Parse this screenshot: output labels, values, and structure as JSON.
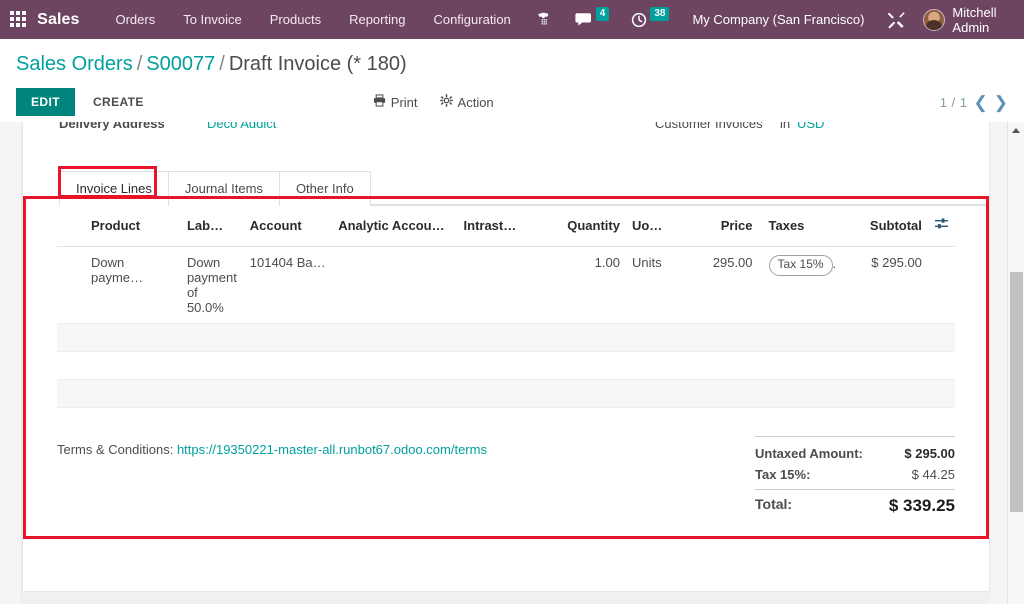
{
  "navbar": {
    "apps_icon": "apps-grid-icon",
    "brand": "Sales",
    "menu": [
      {
        "label": "Orders"
      },
      {
        "label": "To Invoice"
      },
      {
        "label": "Products"
      },
      {
        "label": "Reporting"
      },
      {
        "label": "Configuration"
      }
    ],
    "phone_icon": "phone-icon",
    "messages_icon": "chat-bubble-icon",
    "messages_count": "4",
    "activities_icon": "clock-icon",
    "activities_count": "38",
    "company": "My Company (San Francisco)",
    "debug_icon": "tools-icon",
    "user_name": "Mitchell Admin",
    "avatar": "user-avatar",
    "bg_color": "#6e4561",
    "badge_color": "#00A09D"
  },
  "breadcrumb": {
    "root": "Sales Orders",
    "parent": "S00077",
    "current": "Draft Invoice (* 180)",
    "separator": "/"
  },
  "controlpanel": {
    "edit_label": "EDIT",
    "create_label": "CREATE",
    "print_label": "Print",
    "print_icon": "printer-icon",
    "action_label": "Action",
    "action_icon": "gear-icon",
    "pager_value": "1 / 1",
    "prev_icon": "chevron-left-icon",
    "next_icon": "chevron-right-icon",
    "edit_color": "#00847e"
  },
  "form_cut": {
    "delivery_address_label": "Delivery Address",
    "delivery_address_value": "Deco Addict",
    "journal_label": "Customer Invoices",
    "in_label": "in",
    "currency": "USD"
  },
  "tabs": [
    {
      "label": "Invoice Lines",
      "active": true
    },
    {
      "label": "Journal Items",
      "active": false
    },
    {
      "label": "Other Info",
      "active": false
    }
  ],
  "lines_table": {
    "columns": [
      "Product",
      "Lab…",
      "Account",
      "Analytic Accou…",
      "Intrast…",
      "Quantity",
      "Uo…",
      "Price",
      "Taxes",
      "Subtotal"
    ],
    "optional_columns_icon": "sliders-icon",
    "rows": [
      {
        "product": "Down payme…",
        "label": "Down payment of 50.0%",
        "account": "101404 Ba…",
        "analytic_account": "",
        "intrastat": "",
        "quantity": "1.00",
        "uom": "Units",
        "price": "295.00",
        "taxes": "Tax 15%",
        "taxes_suffix": ".",
        "subtotal": "$ 295.00"
      }
    ],
    "empty_rows": 2
  },
  "terms": {
    "label": "Terms & Conditions:",
    "url": "https://19350221-master-all.runbot67.odoo.com/terms"
  },
  "totals": {
    "untaxed_label": "Untaxed Amount:",
    "untaxed_value": "$ 295.00",
    "tax_label": "Tax 15%:",
    "tax_value": "$ 44.25",
    "total_label": "Total:",
    "total_value": "$ 339.25"
  },
  "annotations": {
    "color": "#e8152a",
    "tab_highlight": "Invoice Lines tab",
    "main_highlight": "Invoice lines and totals region"
  }
}
